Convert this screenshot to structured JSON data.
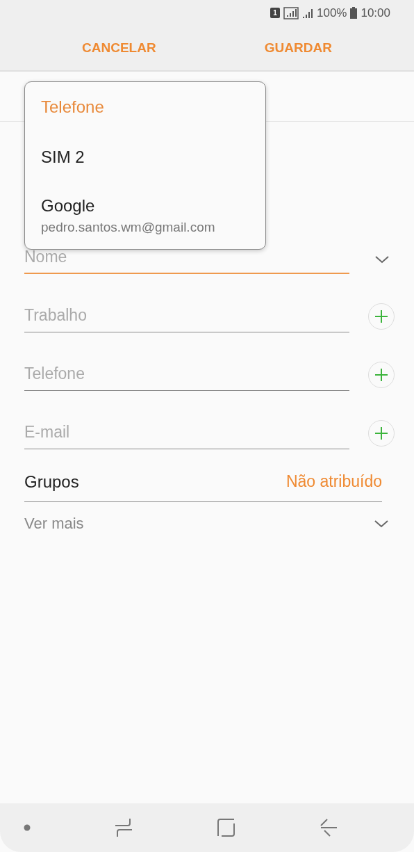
{
  "status_bar": {
    "sim_badge": "1",
    "battery_text": "100%",
    "time": "10:00"
  },
  "header": {
    "actions": [
      {
        "label": "CANCELAR"
      },
      {
        "label": "GUARDAR"
      }
    ]
  },
  "account_menu": {
    "items": [
      {
        "label": "Telefone",
        "selected": true
      },
      {
        "label": "SIM 2",
        "selected": false
      },
      {
        "label": "Google",
        "subtitle": "pedro.santos.wm@gmail.com",
        "selected": false
      }
    ]
  },
  "fields": [
    {
      "placeholder": "Nome",
      "focused": true,
      "kind": "expand"
    },
    {
      "placeholder": "Trabalho",
      "focused": false,
      "kind": "add"
    },
    {
      "placeholder": "Telefone",
      "focused": false,
      "kind": "add"
    },
    {
      "placeholder": "E-mail",
      "focused": false,
      "kind": "add"
    }
  ],
  "groups": {
    "label": "Grupos",
    "value": "Não atribuído"
  },
  "more": {
    "label": "Ver mais"
  }
}
